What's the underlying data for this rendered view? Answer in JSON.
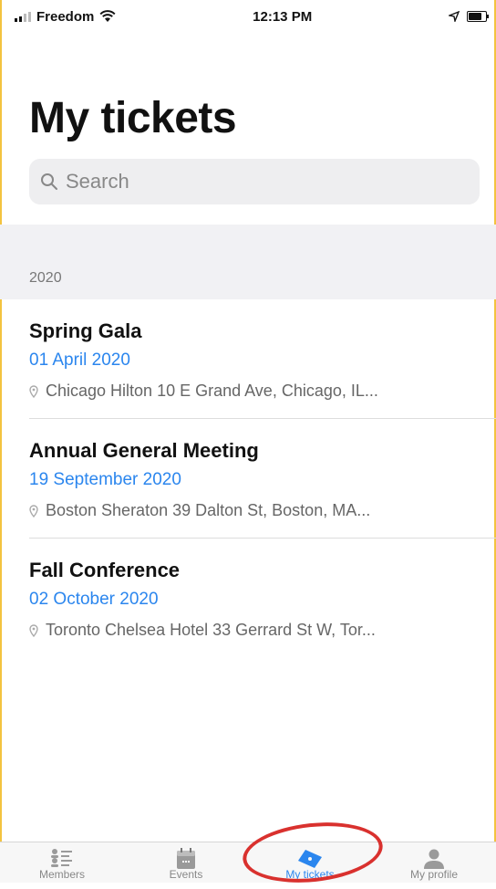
{
  "status_bar": {
    "carrier": "Freedom",
    "time": "12:13 PM"
  },
  "page": {
    "title": "My tickets"
  },
  "search": {
    "placeholder": "Search"
  },
  "section": {
    "header": "2020"
  },
  "tickets": [
    {
      "name": "Spring Gala",
      "date": "01 April 2020",
      "location": "Chicago Hilton 10 E Grand Ave, Chicago, IL..."
    },
    {
      "name": "Annual General Meeting",
      "date": "19 September 2020",
      "location": "Boston Sheraton 39 Dalton St, Boston, MA..."
    },
    {
      "name": "Fall Conference",
      "date": "02 October 2020",
      "location": "Toronto Chelsea Hotel 33 Gerrard St W, Tor..."
    }
  ],
  "tabs": [
    {
      "label": "Members",
      "icon": "members-icon"
    },
    {
      "label": "Events",
      "icon": "calendar-icon"
    },
    {
      "label": "My tickets",
      "icon": "ticket-icon",
      "active": true
    },
    {
      "label": "My profile",
      "icon": "profile-icon"
    }
  ],
  "colors": {
    "accent": "#2b86ee",
    "annotation": "#d9312e",
    "frame": "#f3c33f"
  }
}
